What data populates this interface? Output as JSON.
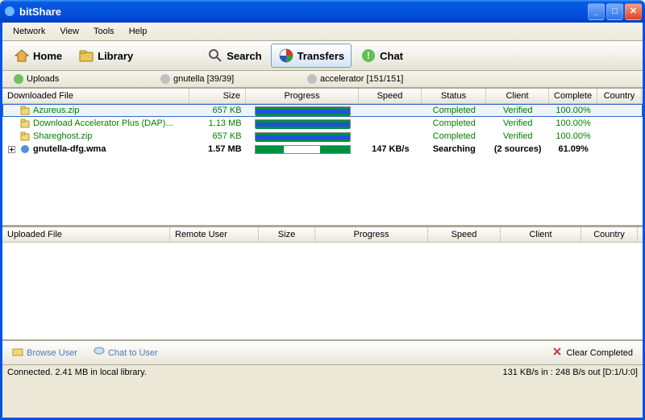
{
  "app": {
    "title": "bitShare"
  },
  "menu": {
    "network": "Network",
    "view": "View",
    "tools": "Tools",
    "help": "Help"
  },
  "toolbar": {
    "home": "Home",
    "library": "Library",
    "search": "Search",
    "transfers": "Transfers",
    "chat": "Chat"
  },
  "filters": {
    "uploads": "Uploads",
    "gnutella": "gnutella [39/39]",
    "accelerator": "accelerator [151/151]"
  },
  "dl_headers": {
    "file": "Downloaded File",
    "size": "Size",
    "progress": "Progress",
    "speed": "Speed",
    "status": "Status",
    "client": "Client",
    "complete": "Complete",
    "country": "Country"
  },
  "downloads": [
    {
      "file": "Azureus.zip",
      "size": "657 KB",
      "speed": "",
      "status": "Completed",
      "client": "Verified",
      "complete": "100.00%",
      "green": true,
      "sel": true,
      "prog_full": true
    },
    {
      "file": "Download Accelerator Plus (DAP)...",
      "size": "1.13 MB",
      "speed": "",
      "status": "Completed",
      "client": "Verified",
      "complete": "100.00%",
      "green": true,
      "prog_full": true
    },
    {
      "file": "Shareghost.zip",
      "size": "657 KB",
      "speed": "",
      "status": "Completed",
      "client": "Verified",
      "complete": "100.00%",
      "green": true,
      "prog_full": true
    },
    {
      "file": "gnutella-dfg.wma",
      "size": "1.57 MB",
      "speed": "147 KB/s",
      "status": "Searching",
      "client": "(2 sources)",
      "complete": "61.09%",
      "bold": true,
      "prog_partial": true,
      "expand": true
    }
  ],
  "ul_headers": {
    "file": "Uploaded File",
    "user": "Remote User",
    "size": "Size",
    "progress": "Progress",
    "speed": "Speed",
    "client": "Client",
    "country": "Country"
  },
  "bottom": {
    "browse": "Browse User",
    "chat": "Chat to User",
    "clear": "Clear Completed"
  },
  "status": {
    "left": "Connected. 2.41 MB in local library.",
    "right": "131 KB/s in : 248 B/s out [D:1/U:0]"
  }
}
